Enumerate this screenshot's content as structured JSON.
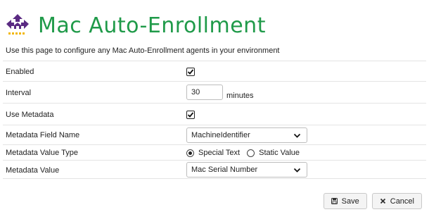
{
  "header": {
    "title": "Mac Auto-Enrollment",
    "icon": "network-sitemap-icon",
    "description": "Use this page to configure any Mac Auto-Enrollment agents in your environment"
  },
  "colors": {
    "title_green": "#1f9a49",
    "icon_purple": "#5a2a82",
    "icon_yellow": "#f2b705"
  },
  "fields": {
    "enabled": {
      "label": "Enabled",
      "checked": true
    },
    "interval": {
      "label": "Interval",
      "value": "30",
      "unit": "minutes"
    },
    "use_metadata": {
      "label": "Use Metadata",
      "checked": true
    },
    "metadata_field_name": {
      "label": "Metadata Field Name",
      "selected": "MachineIdentifier"
    },
    "metadata_value_type": {
      "label": "Metadata Value Type",
      "options": [
        "Special Text",
        "Static Value"
      ],
      "selected": "Special Text"
    },
    "metadata_value": {
      "label": "Metadata Value",
      "selected": "Mac Serial Number"
    }
  },
  "actions": {
    "save_label": "Save",
    "cancel_label": "Cancel"
  }
}
